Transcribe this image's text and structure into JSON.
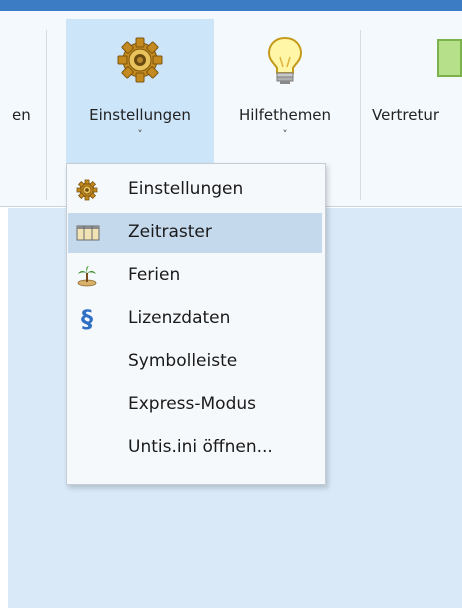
{
  "ribbon": {
    "partial_left_label": "en",
    "buttons": [
      {
        "label": "Einstellungen",
        "chevron": "˅",
        "icon": "gear-icon"
      },
      {
        "label": "Hilfethemen",
        "chevron": "˅",
        "icon": "lightbulb-icon"
      }
    ],
    "partial_right_label": "Vertretur"
  },
  "menu": {
    "items": [
      {
        "label": "Einstellungen",
        "icon": "gear-icon"
      },
      {
        "label": "Zeitraster",
        "icon": "timetable-grid-icon",
        "highlighted": true
      },
      {
        "label": "Ferien",
        "icon": "palm-island-icon"
      },
      {
        "label": "Lizenzdaten",
        "icon": "license-paragraph-icon"
      },
      {
        "label": "Symbolleiste"
      },
      {
        "label": "Express-Modus"
      },
      {
        "label": "Untis.ini öffnen..."
      }
    ]
  },
  "colors": {
    "title_bar": "#3c7cc4",
    "ribbon_background": "#f4f9fd",
    "active_button": "#cde5f9",
    "menu_highlight": "#c4d9ec",
    "content_background": "#d9e9f8"
  }
}
